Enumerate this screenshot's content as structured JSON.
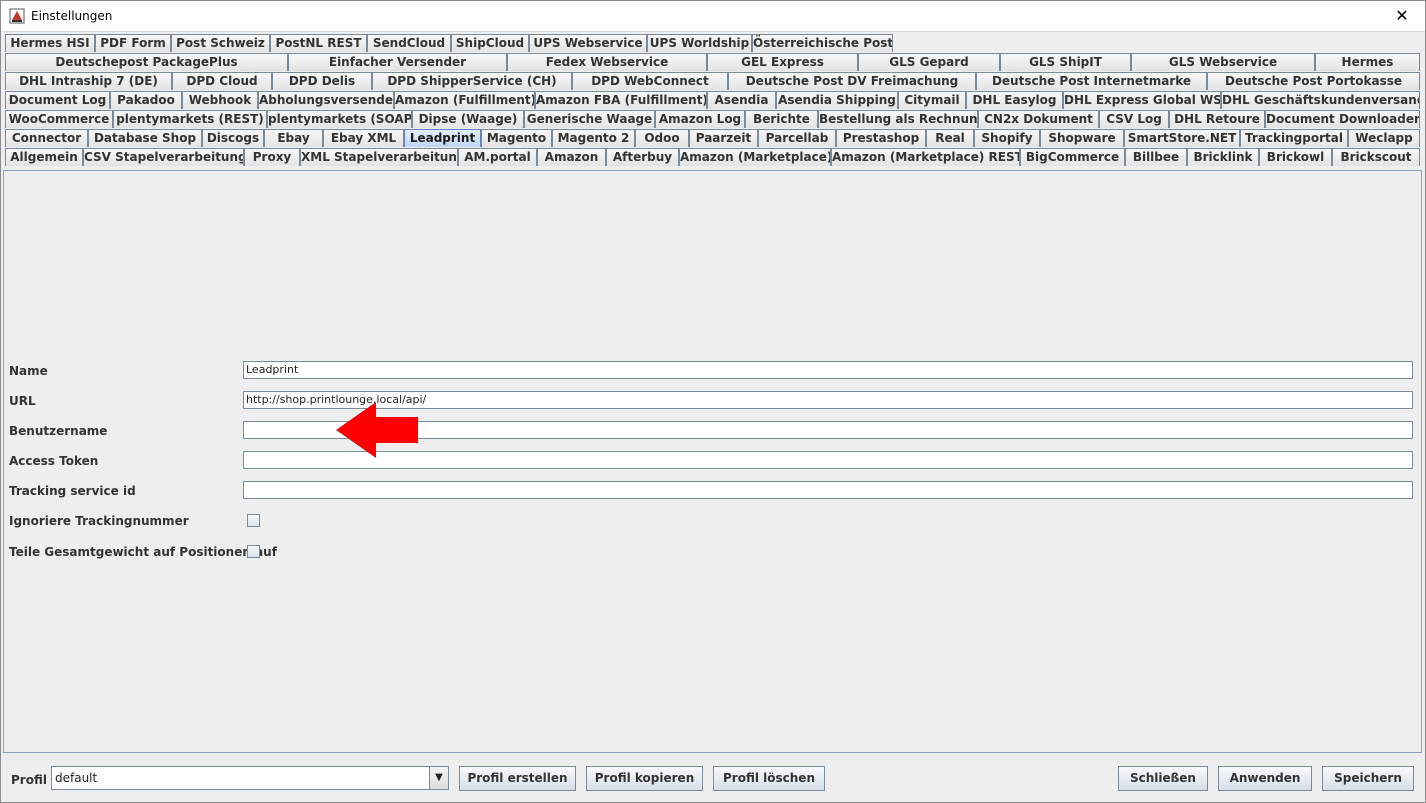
{
  "window": {
    "title": "Einstellungen",
    "close_glyph": "✕"
  },
  "tab_rows": [
    [
      "Hermes HSI",
      "PDF Form",
      "Post Schweiz",
      "PostNL REST",
      "SendCloud",
      "ShipCloud",
      "UPS Webservice",
      "UPS Worldship",
      "Österreichische Post"
    ],
    [
      "Deutschepost PackagePlus",
      "Einfacher Versender",
      "Fedex Webservice",
      "GEL Express",
      "GLS Gepard",
      "GLS ShipIT",
      "GLS Webservice",
      "Hermes"
    ],
    [
      "DHL Intraship 7 (DE)",
      "DPD Cloud",
      "DPD Delis",
      "DPD ShipperService (CH)",
      "DPD WebConnect",
      "Deutsche Post DV Freimachung",
      "Deutsche Post Internetmarke",
      "Deutsche Post Portokasse"
    ],
    [
      "Document Log",
      "Pakadoo",
      "Webhook",
      "Abholungsversender",
      "Amazon (Fulfillment)",
      "Amazon FBA (Fulfillment)",
      "Asendia",
      "Asendia Shipping",
      "Citymail",
      "DHL Easylog",
      "DHL Express Global WS",
      "DHL Geschäftskundenversand"
    ],
    [
      "WooCommerce",
      "plentymarkets (REST)",
      "plentymarkets (SOAP)",
      "Dipse (Waage)",
      "Generische Waage",
      "Amazon Log",
      "Berichte",
      "Bestellung als Rechnung",
      "CN2x Dokument",
      "CSV Log",
      "DHL Retoure",
      "Document Downloader"
    ],
    [
      "Connector",
      "Database Shop",
      "Discogs",
      "Ebay",
      "Ebay XML",
      "Leadprint",
      "Magento",
      "Magento 2",
      "Odoo",
      "Paarzeit",
      "Parcellab",
      "Prestashop",
      "Real",
      "Shopify",
      "Shopware",
      "SmartStore.NET",
      "Trackingportal",
      "Weclapp"
    ],
    [
      "Allgemein",
      "CSV Stapelverarbeitung",
      "Proxy",
      "XML Stapelverarbeitung",
      "AM.portal",
      "Amazon",
      "Afterbuy",
      "Amazon (Marketplace)",
      "Amazon (Marketplace) REST",
      "BigCommerce",
      "Billbee",
      "Bricklink",
      "Brickowl",
      "Brickscout"
    ]
  ],
  "active_tab": "Leadprint",
  "form": {
    "fields": [
      {
        "label": "Name",
        "value": "Leadprint"
      },
      {
        "label": "URL",
        "value": "http://shop.printlounge.local/api/"
      },
      {
        "label": "Benutzername",
        "value": ""
      },
      {
        "label": "Access Token",
        "value": ""
      },
      {
        "label": "Tracking service id",
        "value": ""
      }
    ],
    "checkboxes": [
      {
        "label": "Ignoriere Trackingnummer",
        "checked": false
      },
      {
        "label": "Teile Gesamtgewicht auf Positionen auf",
        "checked": false
      }
    ]
  },
  "annotation": {
    "color": "#ff0000",
    "direction": "left"
  },
  "bottom": {
    "profil_label": "Profil",
    "profil_value": "default",
    "buttons": {
      "create": "Profil erstellen",
      "copy": "Profil kopieren",
      "delete": "Profil löschen",
      "close": "Schließen",
      "apply": "Anwenden",
      "save": "Speichern"
    }
  }
}
